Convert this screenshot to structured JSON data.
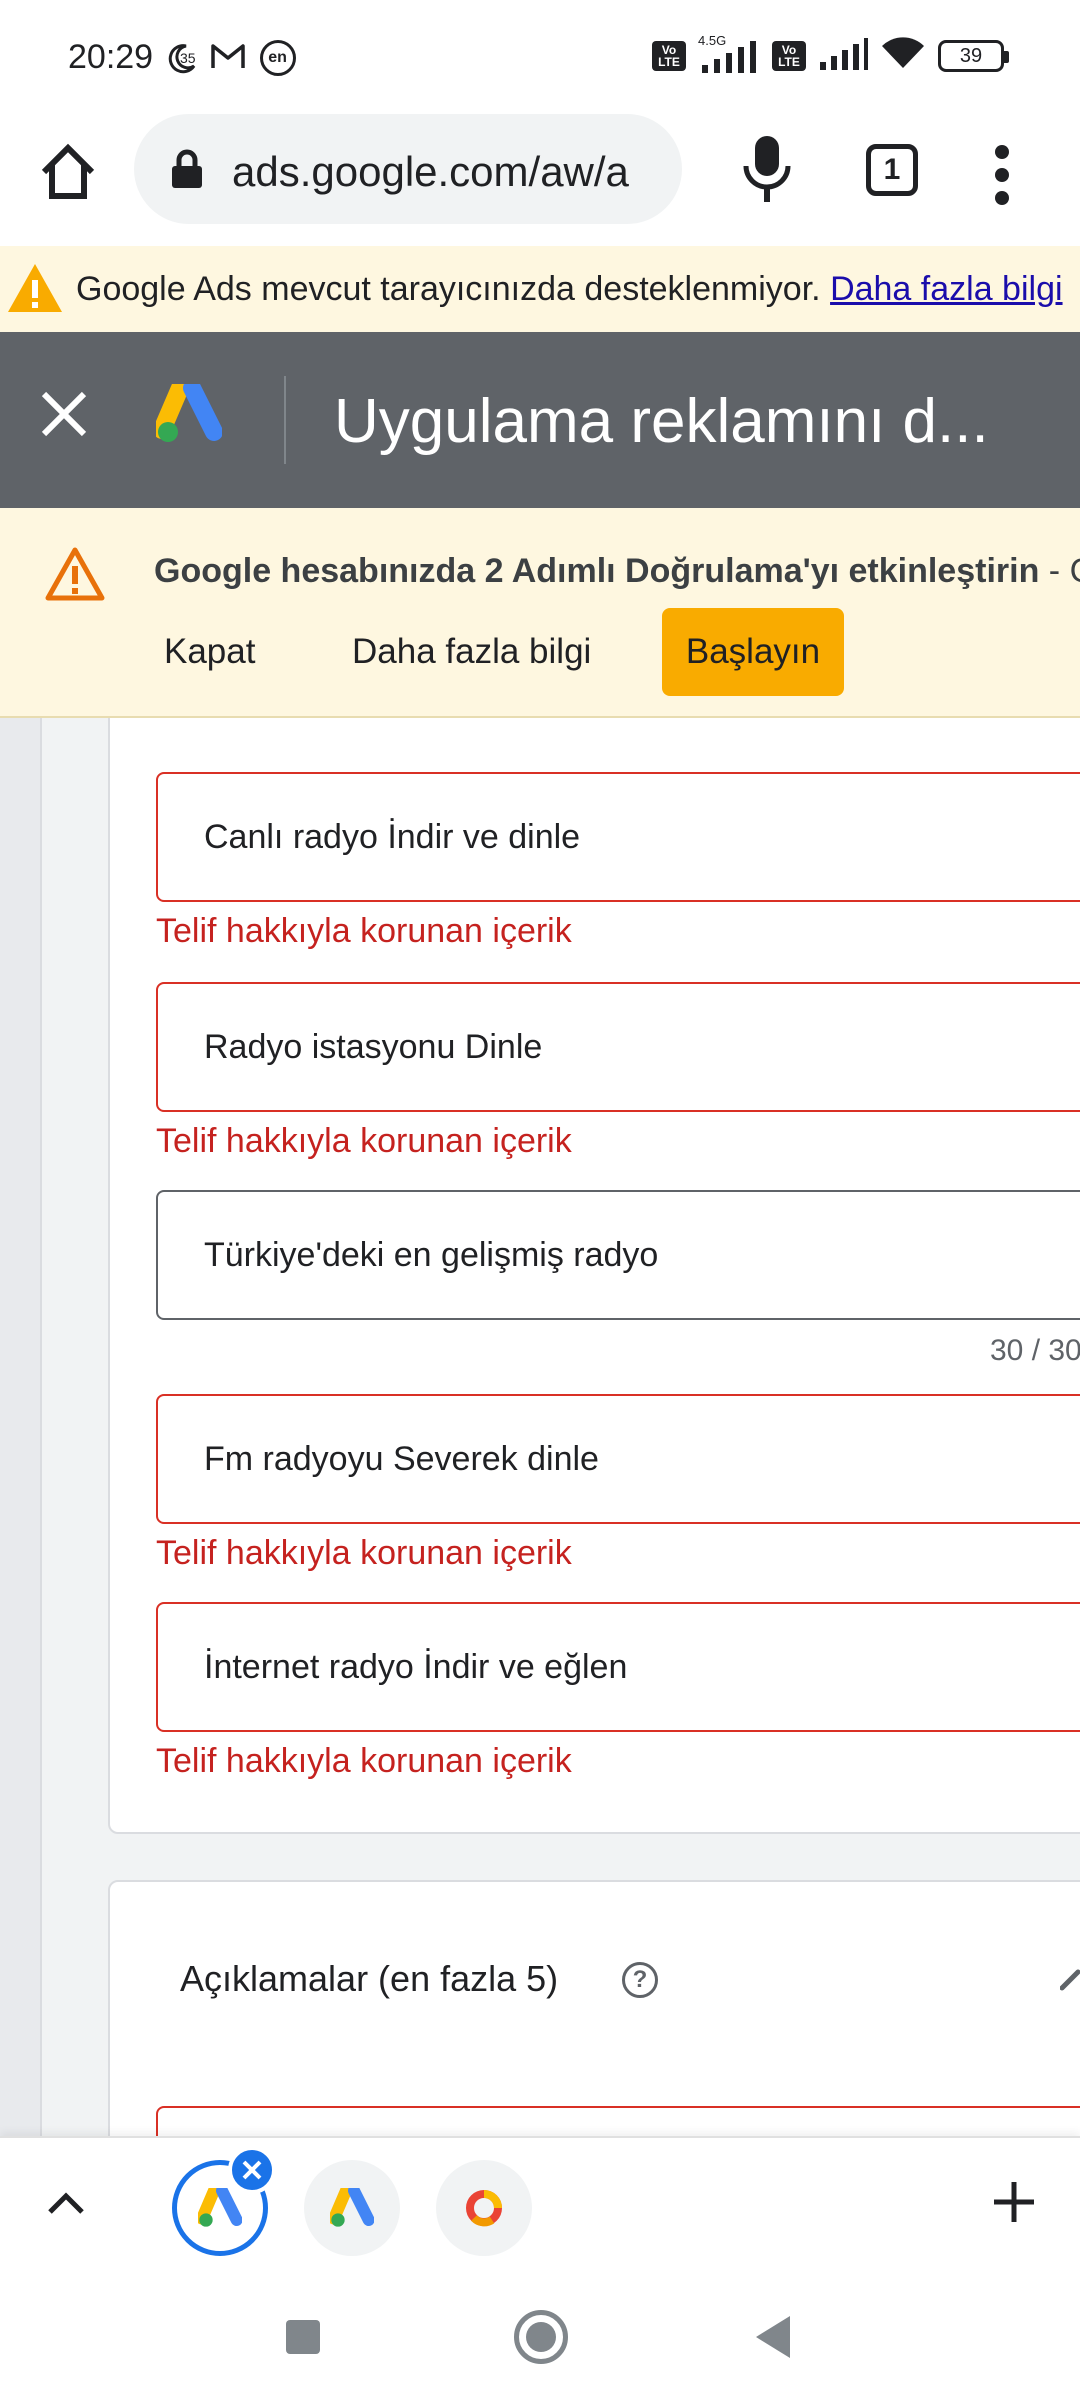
{
  "status_bar": {
    "time": "20:29",
    "moon_badge": "35",
    "lang_badge": "en",
    "net_label": "4.5G",
    "volte1": "Vo LTE",
    "volte2": "Vo LTE",
    "battery": "39"
  },
  "browser": {
    "url": "ads.google.com/aw/a",
    "tab_count": "1"
  },
  "unsupported_banner": {
    "message": "Google Ads mevcut tarayıcınızda desteklenmiyor.",
    "link": "Daha fazla bilgi"
  },
  "header": {
    "title": "Uygulama reklamını d..."
  },
  "twosv_banner": {
    "message": "Google hesabınızda 2 Adımlı Doğrulama'yı etkinleştirin",
    "suffix": " - Google",
    "close_label": "Kapat",
    "more_label": "Daha fazla bilgi",
    "start_label": "Başlayın"
  },
  "headlines": [
    {
      "text": "Canlı radyo İndir ve dinle",
      "error": "Telif hakkıyla korunan içerik"
    },
    {
      "text": "Radyo istasyonu Dinle",
      "error": "Telif hakkıyla korunan içerik"
    },
    {
      "text": "Türkiye'deki en gelişmiş radyo",
      "counter": "30 / 30"
    },
    {
      "text": "Fm radyoyu Severek dinle",
      "error": "Telif hakkıyla korunan içerik"
    },
    {
      "text": "İnternet radyo İndir ve eğlen",
      "error": "Telif hakkıyla korunan içerik"
    }
  ],
  "descriptions_section": {
    "title": "Açıklamalar (en fazla 5)",
    "help": "?"
  },
  "colors": {
    "error": "#d93025",
    "accent": "#1a73e8",
    "header_bg": "#5f6368",
    "banner_bg": "#fef7e0",
    "start_button": "#f9ab00"
  }
}
